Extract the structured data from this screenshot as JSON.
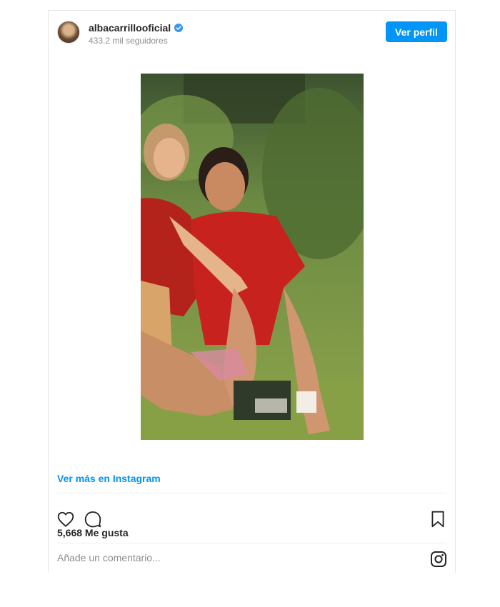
{
  "header": {
    "username": "albacarrillooficial",
    "followers": "433.2 mil seguidores",
    "view_profile_label": "Ver perfil",
    "verified_icon": "verified-badge-icon",
    "accent_color": "#0095f6"
  },
  "post": {
    "view_more_label": "Ver más en Instagram",
    "likes_label": "5,668 Me gusta"
  },
  "actions": {
    "like_icon": "heart-icon",
    "comment_icon": "comment-icon",
    "save_icon": "bookmark-icon",
    "brand_icon": "instagram-icon"
  },
  "comment": {
    "placeholder": "Añade un comentario..."
  }
}
